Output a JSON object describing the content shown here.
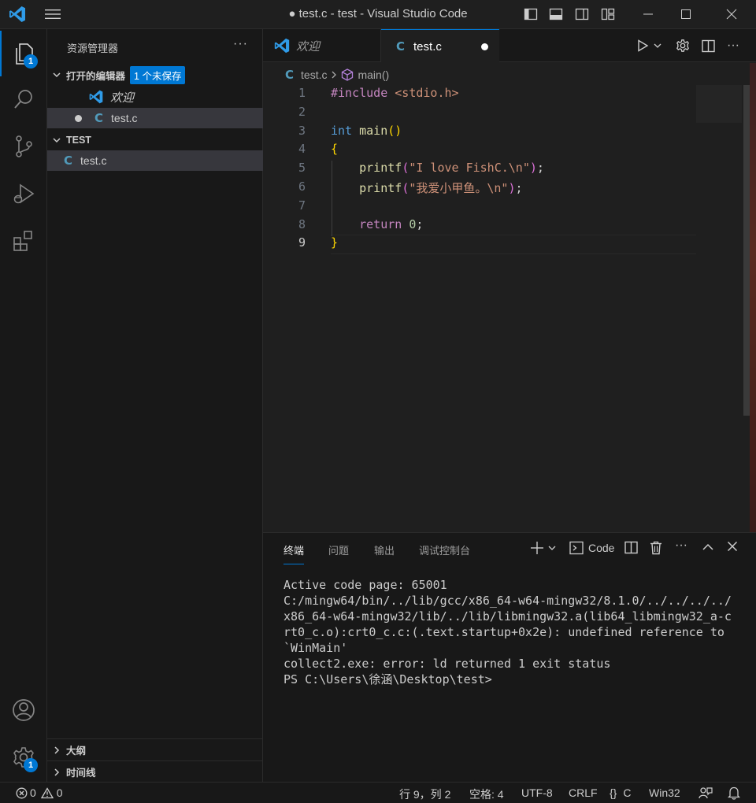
{
  "window": {
    "title": "● test.c - test - Visual Studio Code"
  },
  "activity": {
    "explorer_badge": "1",
    "settings_badge": "1"
  },
  "sidebar": {
    "header": "资源管理器",
    "more": "···",
    "open_editors": {
      "title": "打开的编辑器",
      "unsaved": "1 个未保存",
      "items": [
        {
          "name": "欢迎",
          "icon": "vscode-logo-icon"
        },
        {
          "name": "test.c",
          "icon": "c-file-icon",
          "dirty": true
        }
      ]
    },
    "folder": {
      "title": "TEST",
      "files": [
        {
          "name": "test.c",
          "icon": "c-file-icon"
        }
      ]
    },
    "outline": "大纲",
    "timeline": "时间线"
  },
  "tabs": [
    {
      "label": "欢迎",
      "icon": "vscode-logo-icon"
    },
    {
      "label": "test.c",
      "icon": "c-file-icon",
      "dirty": true
    }
  ],
  "breadcrumb": {
    "file": "test.c",
    "symbol": "main()"
  },
  "code": {
    "line_numbers": [
      "1",
      "2",
      "3",
      "4",
      "5",
      "6",
      "7",
      "8",
      "9"
    ],
    "current_line": 9,
    "lines": [
      {
        "p": [
          [
            "kw",
            "#include "
          ],
          [
            "str",
            "<stdio.h>"
          ]
        ]
      },
      {
        "p": []
      },
      {
        "p": [
          [
            "ty",
            "int "
          ],
          [
            "fn",
            "main"
          ],
          [
            "br1",
            "()"
          ]
        ]
      },
      {
        "p": [
          [
            "br1",
            "{"
          ]
        ]
      },
      {
        "p": [
          [
            "",
            "    "
          ],
          [
            "fn",
            "printf"
          ],
          [
            "br2",
            "("
          ],
          [
            "str",
            "\"I love FishC.\\n\""
          ],
          [
            "br2",
            ")"
          ],
          [
            "",
            ";"
          ]
        ]
      },
      {
        "p": [
          [
            "",
            "    "
          ],
          [
            "fn",
            "printf"
          ],
          [
            "br2",
            "("
          ],
          [
            "str",
            "\"我爱小甲鱼。\\n\""
          ],
          [
            "br2",
            ")"
          ],
          [
            "",
            ";"
          ]
        ]
      },
      {
        "p": []
      },
      {
        "p": [
          [
            "",
            "    "
          ],
          [
            "kw",
            "return "
          ],
          [
            "num",
            "0"
          ],
          [
            "",
            ";"
          ]
        ]
      },
      {
        "p": [
          [
            "br1",
            "}"
          ]
        ]
      }
    ]
  },
  "panel": {
    "tabs": [
      "终端",
      "问题",
      "输出",
      "调试控制台"
    ],
    "terminal_label": "Code",
    "output": [
      "Active code page: 65001",
      "C:/mingw64/bin/../lib/gcc/x86_64-w64-mingw32/8.1.0/../../../../",
      "x86_64-w64-mingw32/lib/../lib/libmingw32.a(lib64_libmingw32_a-c",
      "rt0_c.o):crt0_c.c:(.text.startup+0x2e): undefined reference to",
      "`WinMain'",
      "collect2.exe: error: ld returned 1 exit status",
      "PS C:\\Users\\徐涵\\Desktop\\test>"
    ]
  },
  "status": {
    "errors": "0",
    "warnings": "0",
    "position": "行 9，列 2",
    "spaces": "空格: 4",
    "encoding": "UTF-8",
    "eol": "CRLF",
    "language": "C",
    "platform": "Win32"
  },
  "colors": {
    "accent": "#0078d4",
    "keyword": "#c586c0",
    "type": "#569cd6",
    "function": "#dcdcaa",
    "string": "#ce9178",
    "number": "#b5cea8"
  }
}
